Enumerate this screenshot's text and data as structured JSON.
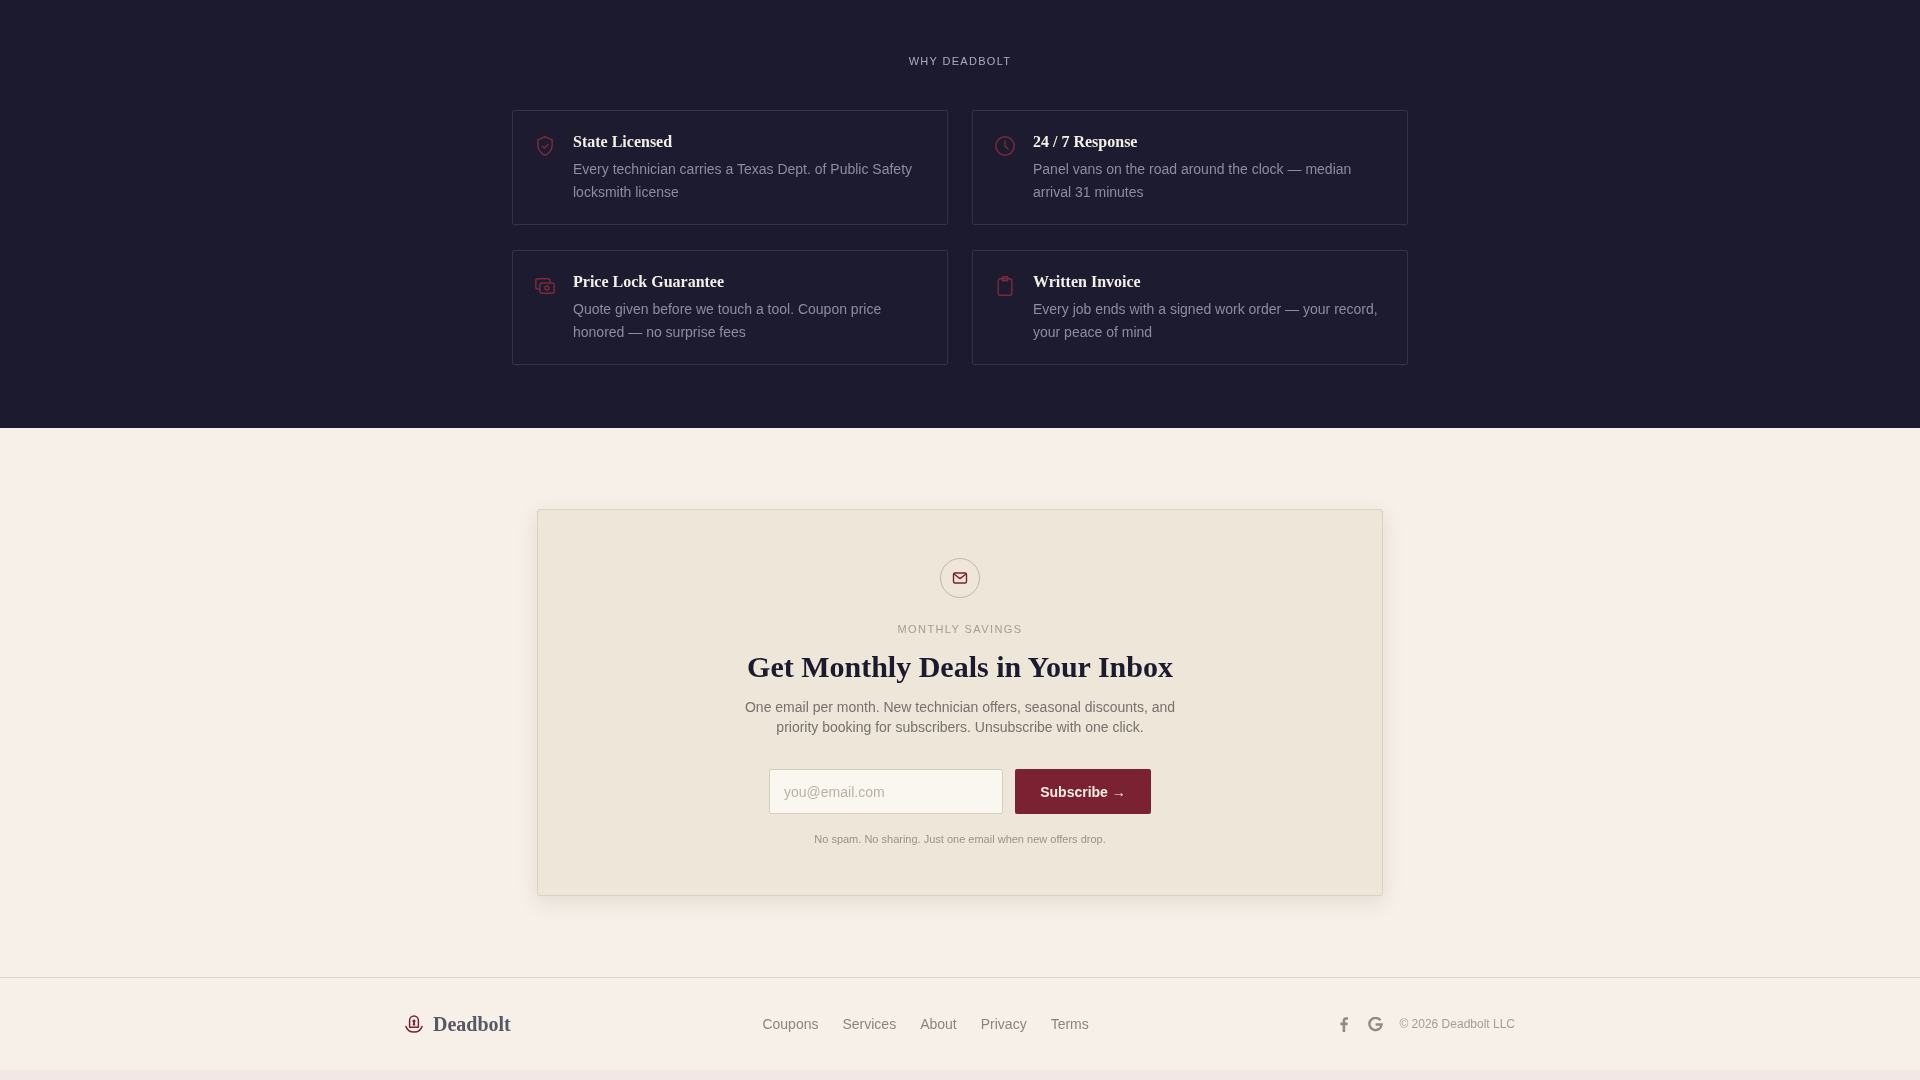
{
  "features": {
    "eyebrow": "WHY DEADBOLT",
    "items": [
      {
        "title": "State Licensed",
        "text": "Every technician carries a Texas Dept. of Public Safety locksmith license"
      },
      {
        "title": "24 / 7 Response",
        "text": "Panel vans on the road around the clock — median arrival 31 minutes"
      },
      {
        "title": "Price Lock Guarantee",
        "text": "Quote given before we touch a tool. Coupon price honored — no surprise fees"
      },
      {
        "title": "Written Invoice",
        "text": "Every job ends with a signed work order — your record, your peace of mind"
      }
    ]
  },
  "newsletter": {
    "eyebrow": "MONTHLY SAVINGS",
    "title": "Get Monthly Deals in Your Inbox",
    "text": "One email per month. New technician offers, seasonal discounts, and priority booking for subscribers. Unsubscribe with one click.",
    "email_field": {
      "placeholder": "you@email.com"
    },
    "button": "Subscribe →",
    "note": "No spam. No sharing. Just one email when new offers drop."
  },
  "footer": {
    "brand": "Deadbolt",
    "links": [
      "Coupons",
      "Services",
      "About",
      "Privacy",
      "Terms"
    ],
    "copyright": "© 2026 Deadbolt LLC"
  }
}
